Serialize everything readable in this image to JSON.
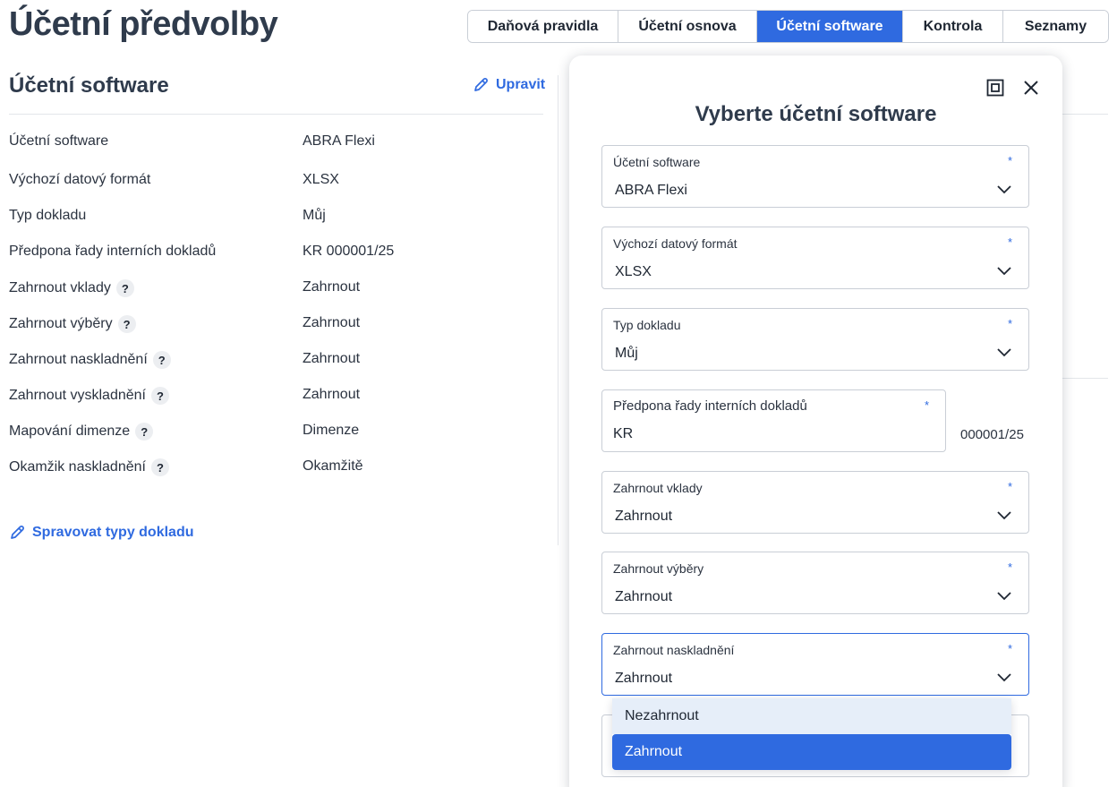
{
  "page": {
    "title": "Účetní předvolby"
  },
  "tabs": [
    {
      "label": "Daňová pravidla",
      "active": false
    },
    {
      "label": "Účetní osnova",
      "active": false
    },
    {
      "label": "Účetní software",
      "active": true
    },
    {
      "label": "Kontrola",
      "active": false
    },
    {
      "label": "Seznamy",
      "active": false
    }
  ],
  "section": {
    "title": "Účetní software",
    "edit_label": "Upravit",
    "manage_label": "Spravovat typy dokladu",
    "rows": [
      {
        "label": "Účetní software",
        "value": "ABRA Flexi",
        "help": false
      },
      {
        "label": "Výchozí datový formát",
        "value": "XLSX",
        "help": false
      },
      {
        "label": "Typ dokladu",
        "value": "Můj",
        "help": false
      },
      {
        "label": "Předpona řady interních dokladů",
        "value": "KR 000001/25",
        "help": false
      },
      {
        "label": "Zahrnout vklady",
        "value": "Zahrnout",
        "help": true
      },
      {
        "label": "Zahrnout výběry",
        "value": "Zahrnout",
        "help": true
      },
      {
        "label": "Zahrnout naskladnění",
        "value": "Zahrnout",
        "help": true
      },
      {
        "label": "Zahrnout vyskladnění",
        "value": "Zahrnout",
        "help": true
      },
      {
        "label": "Mapování dimenze",
        "value": "Dimenze",
        "help": true
      },
      {
        "label": "Okamžik naskladnění",
        "value": "Okamžitě",
        "help": true
      }
    ],
    "help_glyph": "?"
  },
  "modal": {
    "title": "Vyberte účetní software",
    "required_mark": "*",
    "fields": [
      {
        "label": "Účetní software",
        "value": "ABRA Flexi"
      },
      {
        "label": "Výchozí datový formát",
        "value": "XLSX"
      },
      {
        "label": "Typ dokladu",
        "value": "Můj"
      },
      {
        "label": "Předpona řady interních dokladů",
        "value": "KR",
        "suffix": "000001/25"
      },
      {
        "label": "Zahrnout vklady",
        "value": "Zahrnout"
      },
      {
        "label": "Zahrnout výběry",
        "value": "Zahrnout"
      },
      {
        "label": "Zahrnout naskladnění",
        "value": "Zahrnout"
      }
    ],
    "dropdown_options": [
      {
        "label": "Nezahrnout",
        "state": "hover"
      },
      {
        "label": "Zahrnout",
        "state": "selected"
      }
    ]
  },
  "colors": {
    "accent": "#2f6ae0",
    "text": "#2f3b4c",
    "border": "#c9ced6"
  },
  "icons": {
    "edit": "pencil-icon",
    "maximize": "maximize-icon",
    "close": "close-icon",
    "chevron": "chevron-down-icon"
  }
}
